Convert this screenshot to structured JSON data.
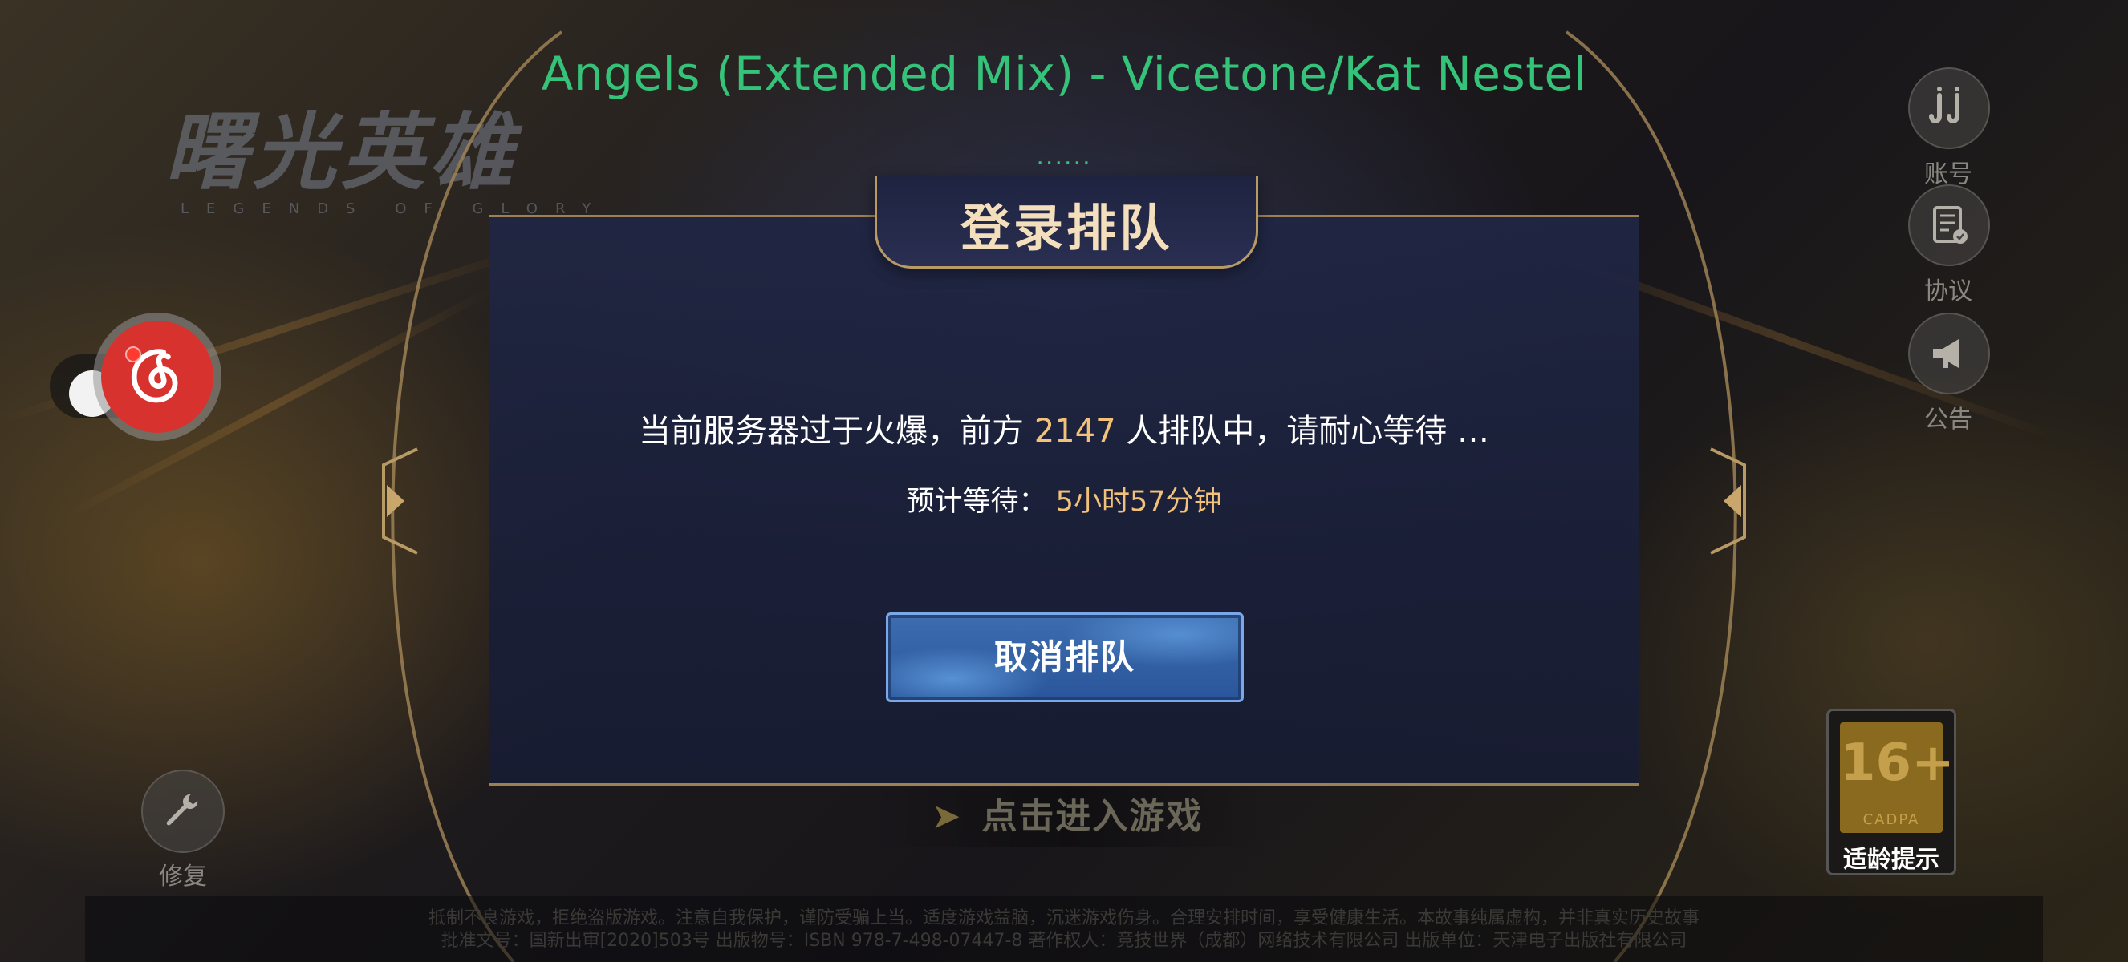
{
  "song": {
    "title": "Angels (Extended Mix) - Vicetone/Kat Nestel",
    "lyric_placeholder": "......"
  },
  "logo": {
    "text_cn": "曙光英雄",
    "text_en": "LEGENDS OF GLORY"
  },
  "dialog": {
    "title": "登录排队",
    "queue_prefix": "当前服务器过于火爆，前方 ",
    "queue_count": "2147",
    "queue_suffix": " 人排队中，请耐心等待 …",
    "wait_label": "预计等待：",
    "wait_time": "5小时57分钟",
    "cancel_label": "取消排队"
  },
  "enter_game": {
    "label": "点击进入游戏"
  },
  "side_menu": {
    "account_label": "账号",
    "agreement_label": "协议",
    "notice_label": "公告"
  },
  "repair": {
    "label": "修复"
  },
  "age_rating": {
    "age": "16+",
    "org": "CADPA",
    "label": "适龄提示"
  },
  "footer": {
    "line1": "抵制不良游戏，拒绝盗版游戏。注意自我保护，谨防受骗上当。适度游戏益脑，沉迷游戏伤身。合理安排时间，享受健康生活。本故事纯属虚构，并非真实历史故事",
    "line2": "批准文号：国新出审[2020]503号 出版物号：ISBN 978-7-498-07447-8 著作权人：竞技世界（成都）网络技术有限公司 出版单位：天津电子出版社有限公司"
  },
  "colors": {
    "song_green": "#35c37a",
    "highlight_gold": "#f2c27a",
    "frame_gold": "#b89a64",
    "button_blue": "#3d6db0"
  },
  "icons": {
    "netease": "netease-music-icon",
    "account": "account-icon",
    "agreement": "agreement-icon",
    "notice": "megaphone-icon",
    "repair": "wrench-icon",
    "enter": "chevron-right-icon"
  }
}
